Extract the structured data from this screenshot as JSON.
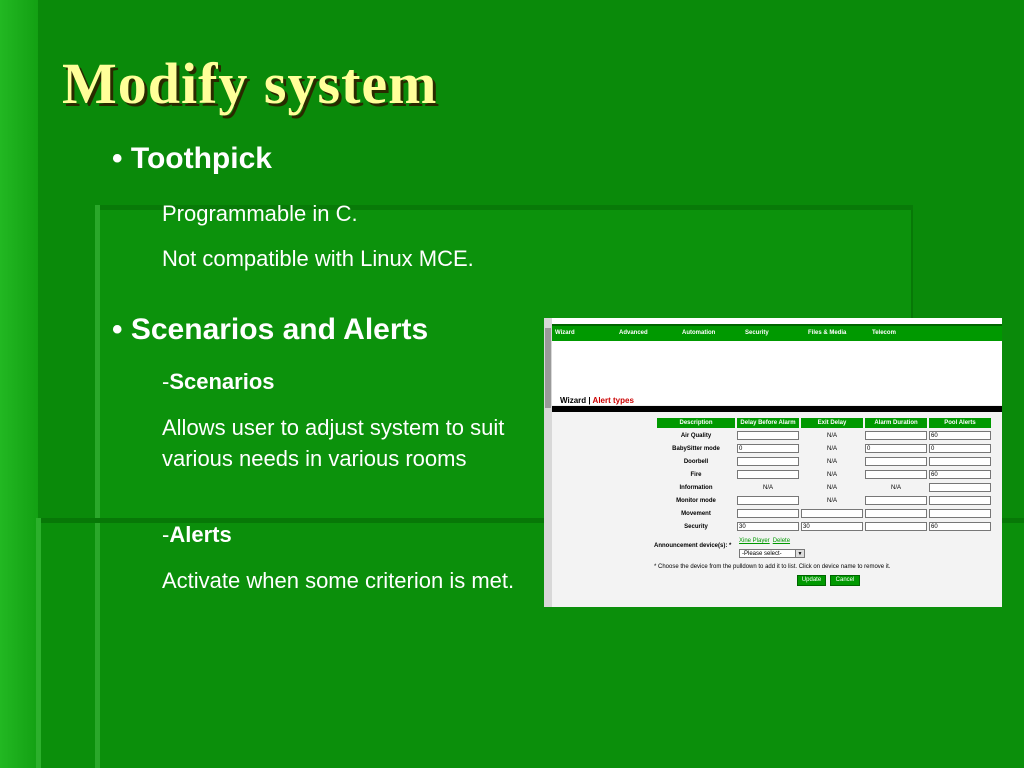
{
  "slide": {
    "title": "Modify system",
    "bullet1": {
      "bullet": "•",
      "heading": "Toothpick",
      "lines": [
        "Programmable in C.",
        "Not compatible with Linux MCE."
      ]
    },
    "bullet2": {
      "bullet": "•",
      "heading": "Scenarios and Alerts",
      "scenarios_dash": "-",
      "scenarios_label": "Scenarios",
      "scenarios_desc": "Allows user to adjust system to suit various needs in various rooms",
      "alerts_dash": "-",
      "alerts_label": "Alerts",
      "alerts_desc": "Activate when some criterion is met."
    }
  },
  "screenshot": {
    "nav": [
      "Wizard",
      "Advanced",
      "Automation",
      "Security",
      "Files & Media",
      "Telecom"
    ],
    "breadcrumb": {
      "part1": "Wizard",
      "sep": " | ",
      "part2": "Alert types"
    },
    "columns": [
      "Description",
      "Delay Before Alarm",
      "Exit Delay",
      "Alarm Duration",
      "Pool Alerts"
    ],
    "rows": [
      {
        "label": "Air Quality",
        "delay": "",
        "exit": "N/A",
        "duration": "",
        "pool": "60"
      },
      {
        "label": "BabySitter mode",
        "delay": "0",
        "exit": "N/A",
        "duration": "0",
        "pool": "0"
      },
      {
        "label": "Doorbell",
        "delay": "",
        "exit": "N/A",
        "duration": "",
        "pool": ""
      },
      {
        "label": "Fire",
        "delay": "",
        "exit": "N/A",
        "duration": "",
        "pool": "60"
      },
      {
        "label": "Information",
        "delay": "N/A",
        "exit": "N/A",
        "duration": "N/A",
        "pool": ""
      },
      {
        "label": "Monitor mode",
        "delay": "",
        "exit": "N/A",
        "duration": "",
        "pool": ""
      },
      {
        "label": "Movement",
        "delay": "",
        "exit": "",
        "duration": "",
        "pool": ""
      },
      {
        "label": "Security",
        "delay": "30",
        "exit": "30",
        "duration": "",
        "pool": "60"
      }
    ],
    "announcement_label": "Announcement device(s): *",
    "announcement_links": [
      "Xine Player",
      "Delete"
    ],
    "announcement_select": "-Please select-",
    "note": "* Choose the device from the pulldown to add it to list. Click on device name to remove it.",
    "update_label": "Update",
    "cancel_label": "Cancel"
  }
}
